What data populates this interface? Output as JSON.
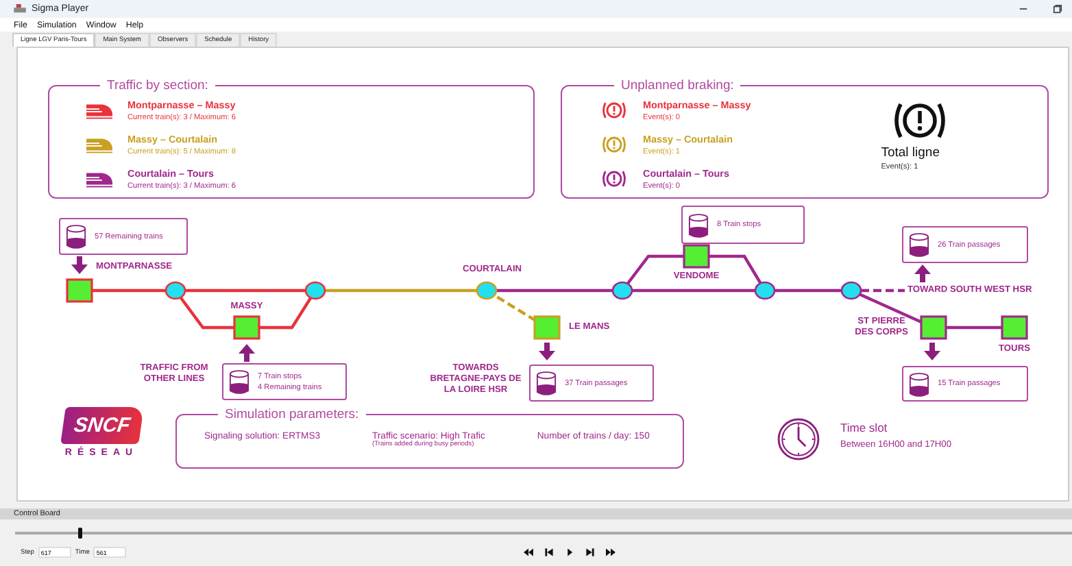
{
  "window": {
    "title": "Sigma Player"
  },
  "menu": [
    "File",
    "Simulation",
    "Window",
    "Help"
  ],
  "tabs": [
    {
      "label": "Ligne LGV Paris-Tours",
      "selected": true
    },
    {
      "label": "Main System",
      "selected": false
    },
    {
      "label": "Observers",
      "selected": false
    },
    {
      "label": "Schedule",
      "selected": false
    },
    {
      "label": "History",
      "selected": false
    }
  ],
  "traffic_by_section": {
    "title": "Traffic by section:",
    "sections": [
      {
        "name": "Montparnasse – Massy",
        "detail": "Current train(s): 3 / Maximum: 6",
        "color": "#e8323c"
      },
      {
        "name": "Massy – Courtalain",
        "detail": "Current train(s): 5 / Maximum: 8",
        "color": "#c9a020"
      },
      {
        "name": "Courtalain – Tours",
        "detail": "Current train(s): 3 / Maximum: 6",
        "color": "#a0288c"
      }
    ]
  },
  "unplanned_braking": {
    "title": "Unplanned braking:",
    "sections": [
      {
        "name": "Montparnasse – Massy",
        "events": "Event(s): 0",
        "color": "#e8323c"
      },
      {
        "name": "Massy – Courtalain",
        "events": "Event(s): 1",
        "color": "#c9a020"
      },
      {
        "name": "Courtalain – Tours",
        "events": "Event(s): 0",
        "color": "#a0288c"
      }
    ],
    "total": {
      "label": "Total ligne",
      "events": "Event(s): 1"
    }
  },
  "network_map": {
    "stations": [
      {
        "name": "MONTPARNASSE",
        "color": "#e8323c"
      },
      {
        "name": "MASSY",
        "color": "#e8323c"
      },
      {
        "name": "LE MANS",
        "color": "#c9a020"
      },
      {
        "name": "VENDOME",
        "color": "#a0288c"
      },
      {
        "name": "ST PIERRE DES CORPS",
        "color": "#a0288c"
      },
      {
        "name": "TOURS",
        "color": "#a0288c"
      }
    ],
    "labels": [
      "COURTALAIN",
      "TRAFFIC FROM OTHER LINES",
      "TOWARDS BRETAGNE-PAYS DE LA LOIRE HSR",
      "TOWARD SOUTH WEST HSR"
    ],
    "info_boxes": [
      {
        "lines": [
          "57 Remaining trains"
        ]
      },
      {
        "lines": [
          "7 Train stops",
          "4 Remaining trains"
        ]
      },
      {
        "lines": [
          "37 Train passages"
        ]
      },
      {
        "lines": [
          "8 Train stops"
        ]
      },
      {
        "lines": [
          "26 Train passages"
        ]
      },
      {
        "lines": [
          "15 Train passages"
        ]
      }
    ]
  },
  "logo": {
    "name": "SNCF",
    "subtitle": "RÉSEAU"
  },
  "simulation_parameters": {
    "title": "Simulation parameters:",
    "signaling": "Signaling solution: ERTMS3",
    "scenario": "Traffic scenario: High Trafic",
    "scenario_note": "(Trains added during busy periods)",
    "trains_per_day": "Number of trains / day: 150"
  },
  "time_slot": {
    "title": "Time slot",
    "value": "Between 16H00 and 17H00"
  },
  "control_board": {
    "title": "Control Board",
    "slider": {
      "level": 0.06
    },
    "step": {
      "label": "Step",
      "value": "617"
    },
    "time": {
      "label": "Time",
      "value": "561"
    }
  }
}
